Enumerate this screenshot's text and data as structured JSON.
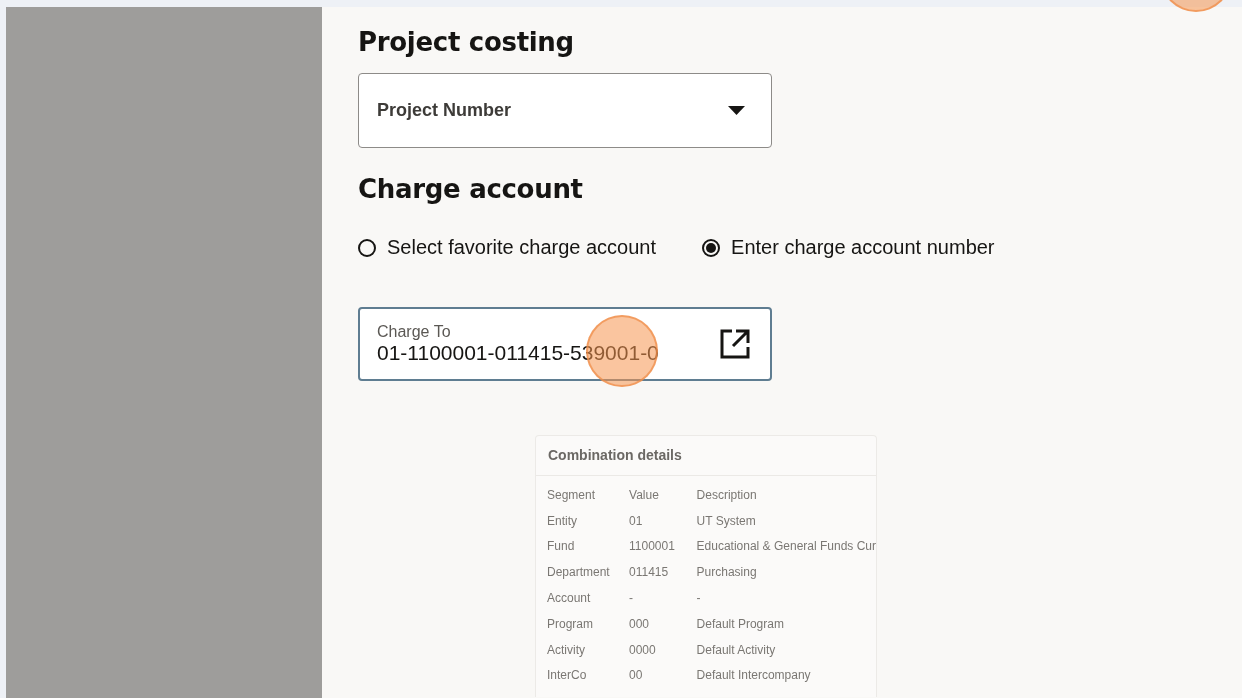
{
  "project_costing": {
    "heading": "Project costing",
    "project_number": {
      "label": "Project Number"
    }
  },
  "charge_account": {
    "heading": "Charge account",
    "options": [
      {
        "label": "Select favorite charge account",
        "selected": false
      },
      {
        "label": "Enter charge account number",
        "selected": true
      }
    ],
    "charge_to": {
      "label": "Charge To",
      "value": "01-1100001-011415-539001-0"
    }
  },
  "combination_details": {
    "title": "Combination details",
    "columns": [
      "Segment",
      "Value",
      "Description"
    ],
    "rows": [
      [
        "Entity",
        "01",
        "UT System"
      ],
      [
        "Fund",
        "1100001",
        "Educational & General Funds Cur"
      ],
      [
        "Department",
        "011415",
        "Purchasing"
      ],
      [
        "Account",
        "-",
        "-"
      ],
      [
        "Program",
        "000",
        "Default Program"
      ],
      [
        "Activity",
        "0000",
        "Default Activity"
      ],
      [
        "InterCo",
        "00",
        "Default Intercompany"
      ]
    ]
  }
}
